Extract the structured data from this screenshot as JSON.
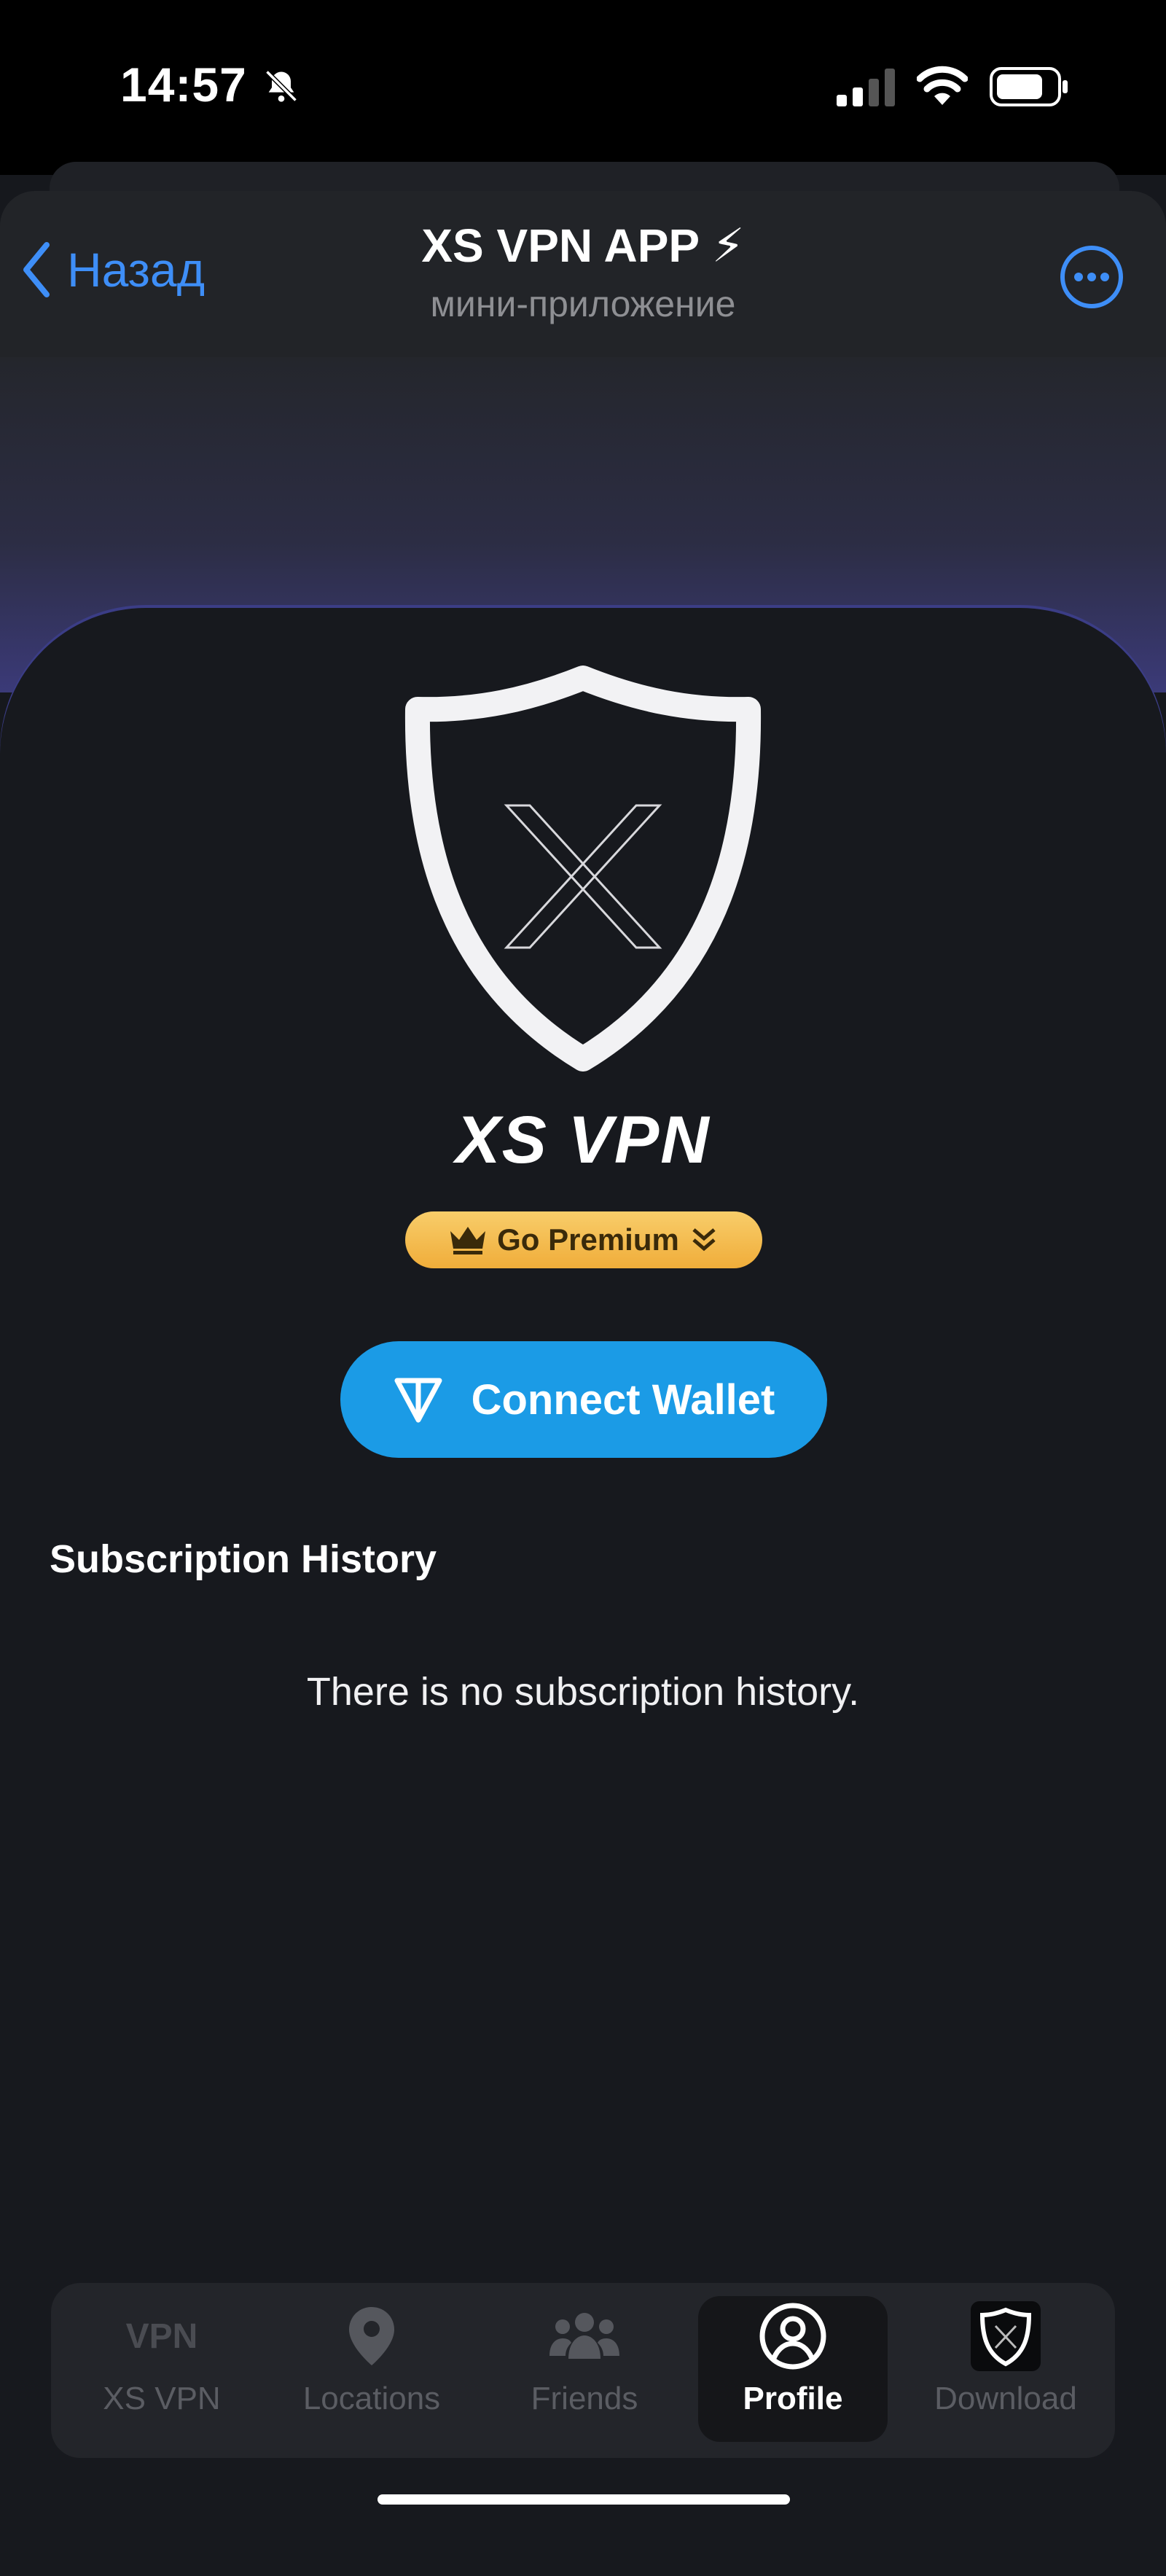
{
  "status_bar": {
    "time": "14:57",
    "icons": [
      "bell-slash-icon",
      "signal-icon",
      "wifi-icon",
      "battery-icon"
    ]
  },
  "header": {
    "back_label": "Назад",
    "title": "XS VPN APP ⚡",
    "subtitle": "мини-приложение",
    "more_icon": "ellipsis-icon"
  },
  "brand": {
    "name": "XS VPN",
    "logo_icon": "shield-x-icon"
  },
  "premium": {
    "label": "Go Premium",
    "icon": "crown-icon"
  },
  "wallet": {
    "label": "Connect Wallet",
    "icon": "ton-icon",
    "color": "#1b9be6"
  },
  "subscription": {
    "title": "Subscription History",
    "empty_text": "There is no subscription history."
  },
  "tabs": [
    {
      "label": "XS VPN",
      "icon_text": "VPN",
      "active": false
    },
    {
      "label": "Locations",
      "icon": "location-pin-icon",
      "active": false
    },
    {
      "label": "Friends",
      "icon": "users-icon",
      "active": false
    },
    {
      "label": "Profile",
      "icon": "profile-icon",
      "active": true
    },
    {
      "label": "Download",
      "icon": "app-logo-icon",
      "active": false
    }
  ],
  "colors": {
    "accent": "#3e8ef7",
    "background": "#17191e",
    "premium": "#f4bd4f"
  }
}
